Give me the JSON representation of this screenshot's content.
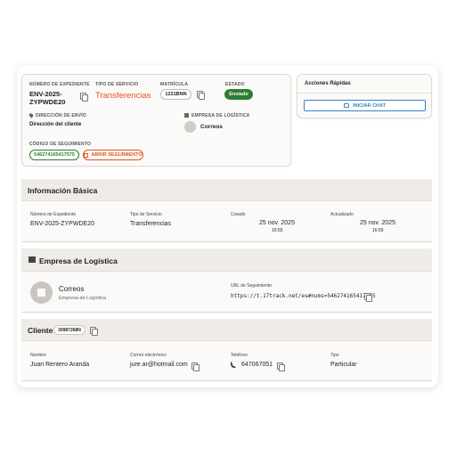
{
  "summary": {
    "expediente_label": "NÚMERO DE EXPEDIENTE",
    "expediente_value_line1": "ENV-2025-",
    "expediente_value_line2": "ZYPWDE20",
    "servicio_label": "TIPO DE SERVICIO",
    "servicio_value": "Transferencias",
    "matricula_label": "MATRÍCULA",
    "matricula_value": "1231BNN",
    "estado_label": "ESTADO",
    "estado_value": "Enviado",
    "direccion_label": "DIRECCIÓN DE ENVÍO",
    "direccion_value": "Dirección del cliente",
    "logistica_label": "EMPRESA DE LOGÍSTICA",
    "logistica_value": "Correos",
    "seguimiento_label": "CÓDIGO DE SEGUIMIENTO",
    "seguimiento_value": "546274165417575",
    "abrir_seguimiento": "ABRIR SEGUIMIENTO"
  },
  "quick_actions": {
    "title": "Acciones Rápidas",
    "chat_button": "INICIAR CHAT"
  },
  "basic_info": {
    "title": "Información Básica",
    "fields": [
      {
        "label": "Número de Expediente",
        "value": "ENV-2025-ZYPWDE20"
      },
      {
        "label": "Tipo de Servicio",
        "value": "Transferencias"
      },
      {
        "label": "Creado",
        "date": "25 nov. 2025",
        "time": "16:55"
      },
      {
        "label": "Actualizado",
        "date": "25 nov. 2025",
        "time": "16:56"
      }
    ]
  },
  "logistics": {
    "title": "Empresa de Logística",
    "company_name": "Correos",
    "company_subtitle": "Empresa de Logística",
    "url_label": "URL de Seguimiento",
    "url_value": "https://t.17track.net/es#nums=546274165417575"
  },
  "client": {
    "title": "Cliente",
    "id_badge": "30987268N",
    "fields": [
      {
        "label": "Nombre",
        "value": "Juan Rentero Aranda"
      },
      {
        "label": "Correo electrónico",
        "value": "jure.ar@hotmail.com"
      },
      {
        "label": "Teléfono",
        "value": "647067051"
      },
      {
        "label": "Tipo",
        "value": "Particular"
      }
    ]
  },
  "colors": {
    "accent_orange": "#e0531f",
    "success_green": "#2e7d32",
    "link_blue": "#3b82c4"
  }
}
